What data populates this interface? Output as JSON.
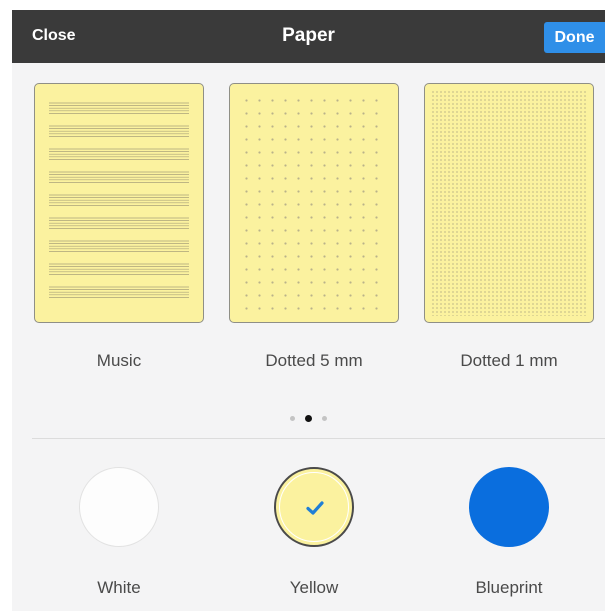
{
  "header": {
    "close_label": "Close",
    "title": "Paper",
    "done_label": "Done"
  },
  "papers": [
    {
      "label": "Music",
      "pattern": "music-staves"
    },
    {
      "label": "Dotted 5 mm",
      "pattern": "dot-grid-5mm"
    },
    {
      "label": "Dotted 1 mm",
      "pattern": "dot-grid-1mm"
    }
  ],
  "pager": {
    "count": 3,
    "active_index": 1
  },
  "colors": [
    {
      "label": "White",
      "hex": "#fdfdfd",
      "selected": false
    },
    {
      "label": "Yellow",
      "hex": "#fbf29f",
      "selected": true
    },
    {
      "label": "Blueprint",
      "hex": "#0a6ede",
      "selected": false
    }
  ],
  "theme": {
    "header_bg": "#3a3a3a",
    "accent": "#2f8fe8",
    "check_color": "#1f7fd6",
    "sheet_bg": "#f4f4f5"
  },
  "icons": {
    "selected_mark": "checkmark-icon"
  }
}
